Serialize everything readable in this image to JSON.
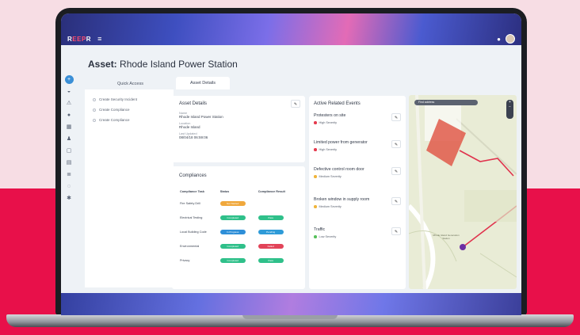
{
  "header": {
    "brand_a": "R",
    "brand_b": "EEP",
    "brand_c": "R"
  },
  "page": {
    "title_prefix": "Asset:",
    "title_name": "Rhode Island Power Station"
  },
  "quick_access": {
    "heading": "Quick Access",
    "items": [
      "Create Security Incident",
      "Create Compliance",
      "Create Compliance"
    ]
  },
  "tabs": [
    "Asset Details"
  ],
  "asset_details": {
    "title": "Asset Details",
    "fields": [
      {
        "label": "Name",
        "value": "Rhode Island Power Station"
      },
      {
        "label": "Location",
        "value": "Rhode Island"
      },
      {
        "label": "Last Updated",
        "value": "08/04/18 06:59:06"
      }
    ]
  },
  "compliances": {
    "title": "Compliances",
    "columns": [
      "Compliance Task",
      "Status",
      "Compliance Result"
    ],
    "rows": [
      {
        "task": "Fire Safety Drill",
        "status": "Not Started",
        "status_color": "#f0a83c",
        "result": "",
        "result_color": ""
      },
      {
        "task": "Electrical Testing",
        "status": "Completed",
        "status_color": "#2fc08a",
        "result": "Pass",
        "result_color": "#2fc08a"
      },
      {
        "task": "Local Building Code",
        "status": "In Progress",
        "status_color": "#2e8fd8",
        "result": "Pending",
        "result_color": "#2e9bd8"
      },
      {
        "task": "Environmental",
        "status": "Completed",
        "status_color": "#2fc08a",
        "result": "Failed",
        "result_color": "#e24459"
      },
      {
        "task": "Privacy",
        "status": "Completed",
        "status_color": "#2fc08a",
        "result": "Pass",
        "result_color": "#2fc08a"
      }
    ]
  },
  "events": {
    "title": "Active Related Events",
    "items": [
      {
        "title": "Protesters on site",
        "severity": "High Severity",
        "color": "#e53a4e"
      },
      {
        "title": "Limited power from generator",
        "severity": "High Severity",
        "color": "#e53a4e"
      },
      {
        "title": "Defective control room door",
        "severity": "Medium Severity",
        "color": "#f0b43a"
      },
      {
        "title": "Broken window in supply room",
        "severity": "Medium Severity",
        "color": "#f0b43a"
      },
      {
        "title": "Traffic",
        "severity": "Low Severity",
        "color": "#56c05a"
      }
    ]
  },
  "map": {
    "search_placeholder": "Find address",
    "zoom_in": "+",
    "zoom_out": "−",
    "site_label": "Rhode Island Generation Station"
  },
  "colors": {
    "accent": "#3a8fd6",
    "brand_red": "#e8104a"
  }
}
